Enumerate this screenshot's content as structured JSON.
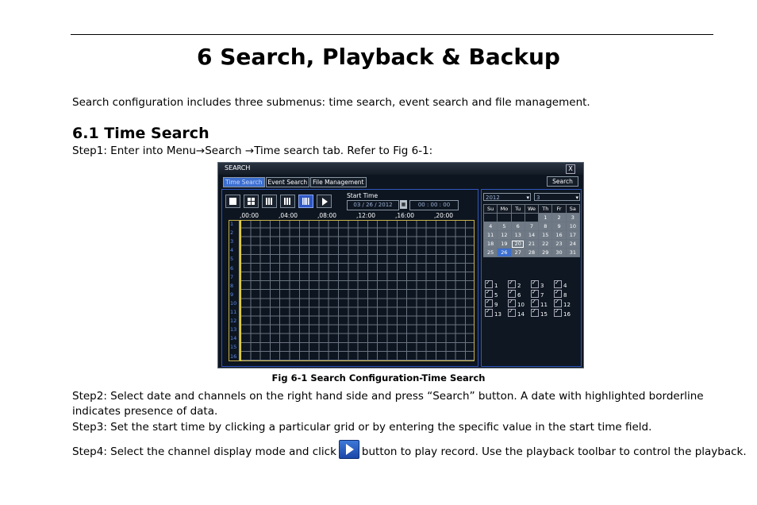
{
  "chapter_title": "6   Search, Playback & Backup",
  "intro": "Search configuration includes three submenus: time search, event search and file management.",
  "section_title": "6.1  Time Search",
  "step1": "Step1: Enter into Menu→Search →Time search tab. Refer to Fig 6-1:",
  "caption": "Fig 6-1 Search Configuration-Time Search",
  "step2": "Step2: Select date and channels on the right hand side and press “Search” button. A date with highlighted borderline indicates presence of data.",
  "step3": "Step3: Set the start time by clicking a particular grid or by entering the specific value in the start time field.",
  "step4_before": "Step4: Select the channel display mode and click",
  "step4_after": "button to play record. Use the playback toolbar to control the playback.",
  "dvr": {
    "title": "SEARCH",
    "close": "X",
    "tabs": [
      "Time Search",
      "Event Search",
      "File Management"
    ],
    "search_button": "Search",
    "start_time_label": "Start Time",
    "date_value": "03 / 26 / 2012",
    "time_value": "00 : 00 : 00",
    "hours": [
      ",00:00",
      ",04:00",
      ",08:00",
      ",12:00",
      ",16:00",
      ",20:00"
    ],
    "channels": [
      "1",
      "2",
      "3",
      "4",
      "5",
      "6",
      "7",
      "8",
      "9",
      "10",
      "11",
      "12",
      "13",
      "14",
      "15",
      "16"
    ],
    "year": "2012",
    "month": "3",
    "weekdays": [
      "Su",
      "Mo",
      "Tu",
      "We",
      "Th",
      "Fr",
      "Sa"
    ],
    "days": [
      "1",
      "2",
      "3",
      "4",
      "5",
      "6",
      "7",
      "8",
      "9",
      "10",
      "11",
      "12",
      "13",
      "14",
      "15",
      "16",
      "17",
      "18",
      "19",
      "20",
      "21",
      "22",
      "23",
      "24",
      "25",
      "26",
      "27",
      "28",
      "29",
      "30",
      "31"
    ],
    "selected_day": "26",
    "data_day": "20",
    "channel_checks": [
      "1",
      "2",
      "3",
      "4",
      "5",
      "6",
      "7",
      "8",
      "9",
      "10",
      "11",
      "12",
      "13",
      "14",
      "15",
      "16"
    ]
  }
}
